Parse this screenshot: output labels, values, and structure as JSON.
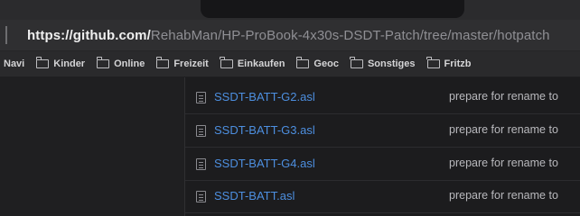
{
  "browser": {
    "url_host": "https://github.com/",
    "url_path": "RehabMan/HP-ProBook-4x30s-DSDT-Patch/tree/master/hotpatch"
  },
  "bookmarks": [
    {
      "label": "Navi",
      "icon": "folder-icon"
    },
    {
      "label": "Kinder",
      "icon": "folder-icon"
    },
    {
      "label": "Online",
      "icon": "folder-icon"
    },
    {
      "label": "Freizeit",
      "icon": "folder-icon"
    },
    {
      "label": "Einkaufen",
      "icon": "folder-icon"
    },
    {
      "label": "Geoc",
      "icon": "folder-icon"
    },
    {
      "label": "Sonstiges",
      "icon": "folder-icon"
    },
    {
      "label": "Fritzb",
      "icon": "folder-icon"
    }
  ],
  "files": [
    {
      "name": "SSDT-BATT-G2.asl",
      "message": "prepare for rename to"
    },
    {
      "name": "SSDT-BATT-G3.asl",
      "message": "prepare for rename to"
    },
    {
      "name": "SSDT-BATT-G4.asl",
      "message": "prepare for rename to"
    },
    {
      "name": "SSDT-BATT.asl",
      "message": "prepare for rename to"
    }
  ],
  "colors": {
    "link": "#4d8fe0",
    "background": "#1c1c1e"
  }
}
